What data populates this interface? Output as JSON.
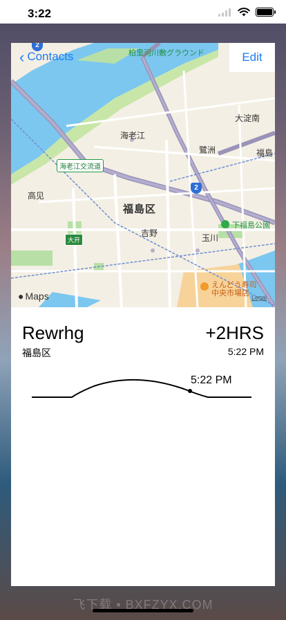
{
  "status_bar": {
    "time": "3:22"
  },
  "nav": {
    "back_label": "Contacts",
    "edit_label": "Edit"
  },
  "map": {
    "labels": {
      "river_park": "柏里河川敷グラウンド",
      "kaiebin": "海老江",
      "osu": "鷺洲",
      "fukushima_ku": "福島区",
      "yoshino": "吉野",
      "tamagawa": "玉川",
      "takami": "高见",
      "shimofukushima_park": "下福島公園",
      "fukushima_right": "福島",
      "oyodo_minami": "大淀南",
      "kaiebin_junction": "海老江交流道",
      "ohiraki": "大开",
      "sushi": "えんどう寿司",
      "sushi_sub": "中央市場店",
      "kaiebin_sign": "海老江"
    },
    "highway_number": "2",
    "maps_logo": "Maps",
    "legal": "Legal"
  },
  "location": {
    "city": "Rewrhg",
    "region": "福島区",
    "offset": "+2HRS",
    "local_time": "5:22 PM",
    "curve_time": "5:22 PM"
  },
  "watermark": "飞下载 • BXFZYX.COM",
  "colors": {
    "accent": "#1a7cf5",
    "water": "#7cc7f0",
    "park": "#b8e0a6",
    "road": "#ffffff",
    "highway": "#9a93b8"
  }
}
